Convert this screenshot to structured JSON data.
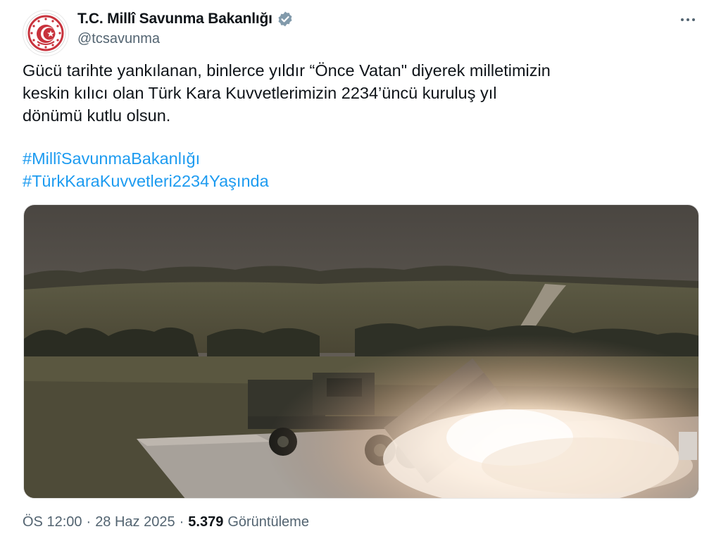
{
  "account": {
    "display_name": "T.C. Millî Savunma Bakanlığı",
    "handle": "@tcsavunma",
    "verified_color": "#829aab"
  },
  "tweet": {
    "text_lines": [
      "Gücü tarihte yankılanan, binlerce yıldır “Önce Vatan\" diyerek milletimizin",
      "keskin kılıcı olan Türk Kara Kuvvetlerimizin 2234’üncü kuruluş yıl",
      "dönümü kutlu olsun."
    ],
    "hashtags": [
      "#MillîSavunmaBakanlığı",
      "#TürkKaraKuvvetleri2234Yaşında"
    ],
    "hashtag_color": "#1d9bf0"
  },
  "meta": {
    "time": "ÖS 12:00",
    "separator": "·",
    "date": "28 Haz 2025",
    "views_count": "5.379",
    "views_label": "Görüntüleme"
  },
  "icons": {
    "more": "more-options-icon",
    "verified": "verified-badge-icon",
    "avatar": "ministry-emblem-icon"
  }
}
